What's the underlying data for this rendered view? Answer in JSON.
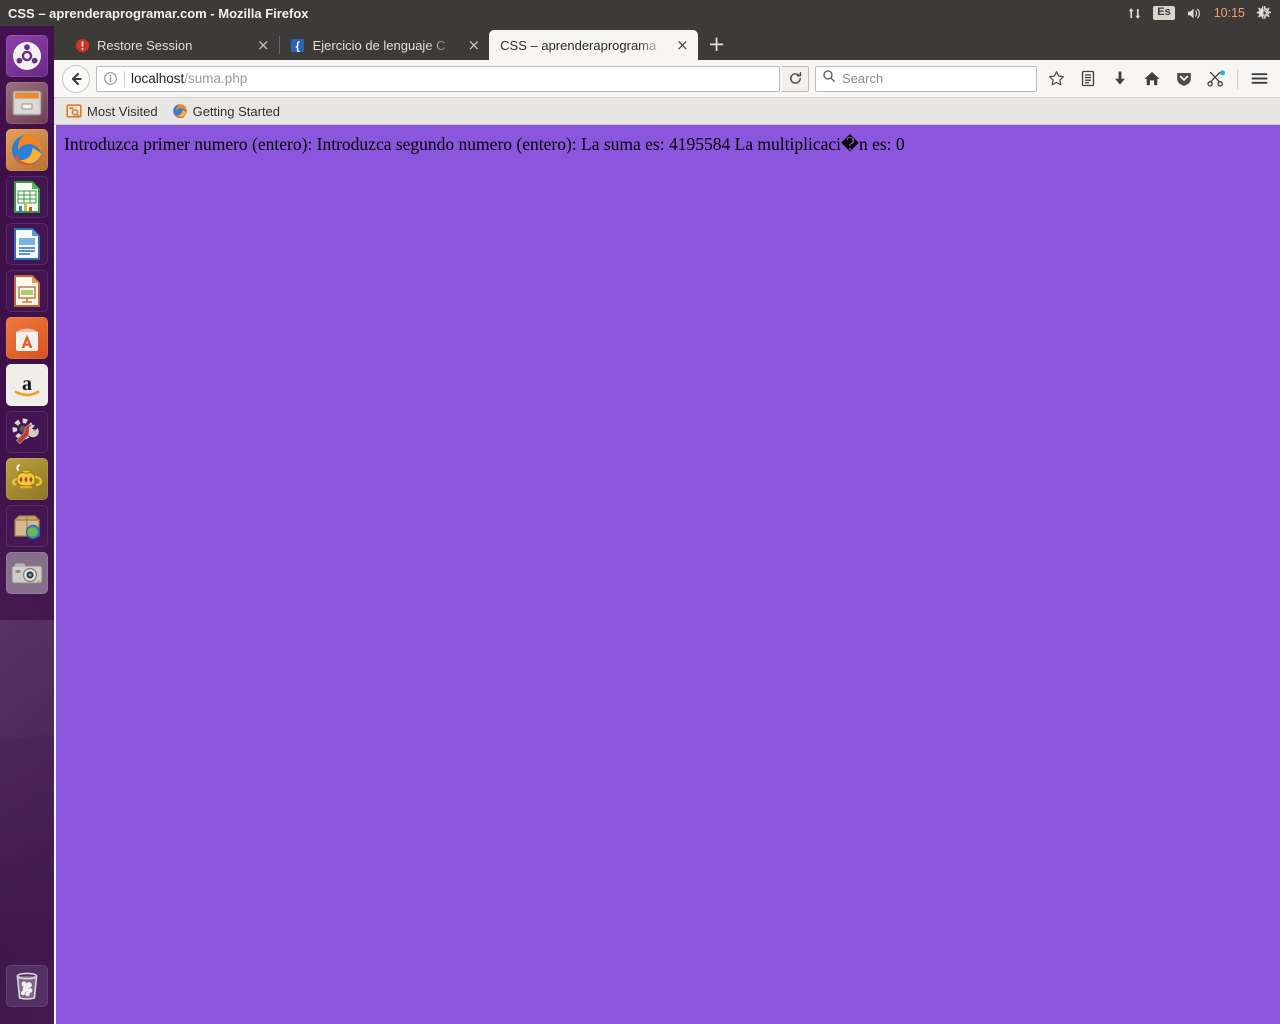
{
  "top_panel": {
    "window_title": "CSS – aprenderaprogramar.com - Mozilla Firefox",
    "tray": {
      "network_icon": "network-up-down-arrows-icon",
      "keyboard_layout": "Es",
      "volume_icon": "volume-speaker-icon",
      "clock": "10:15",
      "session_icon": "system-gear-icon"
    }
  },
  "launcher": {
    "items": [
      {
        "name": "ubuntu-dash",
        "label": "Ubuntu Dash",
        "running": false
      },
      {
        "name": "files",
        "label": "Files",
        "running": true
      },
      {
        "name": "firefox",
        "label": "Firefox Web Browser",
        "running": true
      },
      {
        "name": "libreoffice-calc",
        "label": "LibreOffice Calc",
        "running": false
      },
      {
        "name": "libreoffice-writer",
        "label": "LibreOffice Writer",
        "running": false
      },
      {
        "name": "libreoffice-impress",
        "label": "LibreOffice Impress",
        "running": false
      },
      {
        "name": "ubuntu-software",
        "label": "Ubuntu Software",
        "running": false
      },
      {
        "name": "amazon",
        "label": "Amazon",
        "running": false
      },
      {
        "name": "system-settings",
        "label": "System Settings",
        "running": false
      },
      {
        "name": "help",
        "label": "Ubuntu Help",
        "running": true
      },
      {
        "name": "software-updater",
        "label": "Software Updater",
        "running": false
      },
      {
        "name": "screenshot",
        "label": "Screenshot",
        "running": true
      }
    ],
    "trash_label": "Trash"
  },
  "browser": {
    "tabs": [
      {
        "title": "Restore Session",
        "favicon": "alert-circle-icon",
        "active": false,
        "close_label": "×"
      },
      {
        "title": "Ejercicio de lenguaje C",
        "favicon": "code-brace-icon",
        "active": false,
        "close_label": "×"
      },
      {
        "title": "CSS – aprenderaprograma",
        "favicon": "none",
        "active": true,
        "close_label": "×"
      }
    ],
    "new_tab_label": "+",
    "toolbar": {
      "back_icon": "back-arrow-icon",
      "identity_icon": "info-circle-icon",
      "url_host": "localhost",
      "url_path": "/suma.php",
      "reload_icon": "reload-icon",
      "search_icon": "search-icon",
      "search_placeholder": "Search",
      "bookmark_icon": "star-icon",
      "library_icon": "library-icon",
      "downloads_icon": "download-arrow-icon",
      "home_icon": "home-icon",
      "pocket_icon": "pocket-shield-icon",
      "sync_icon": "sync-scissors-icon",
      "menu_icon": "hamburger-menu-icon"
    },
    "bookmarks": [
      {
        "label": "Most Visited",
        "icon": "most-visited-icon"
      },
      {
        "label": "Getting Started",
        "icon": "firefox-icon"
      }
    ]
  },
  "page": {
    "background_color": "#8b55dd",
    "text": "Introduzca primer numero (entero): Introduzca segundo numero (entero): La suma es: 4195584 La multiplicaci�n es: 0"
  }
}
